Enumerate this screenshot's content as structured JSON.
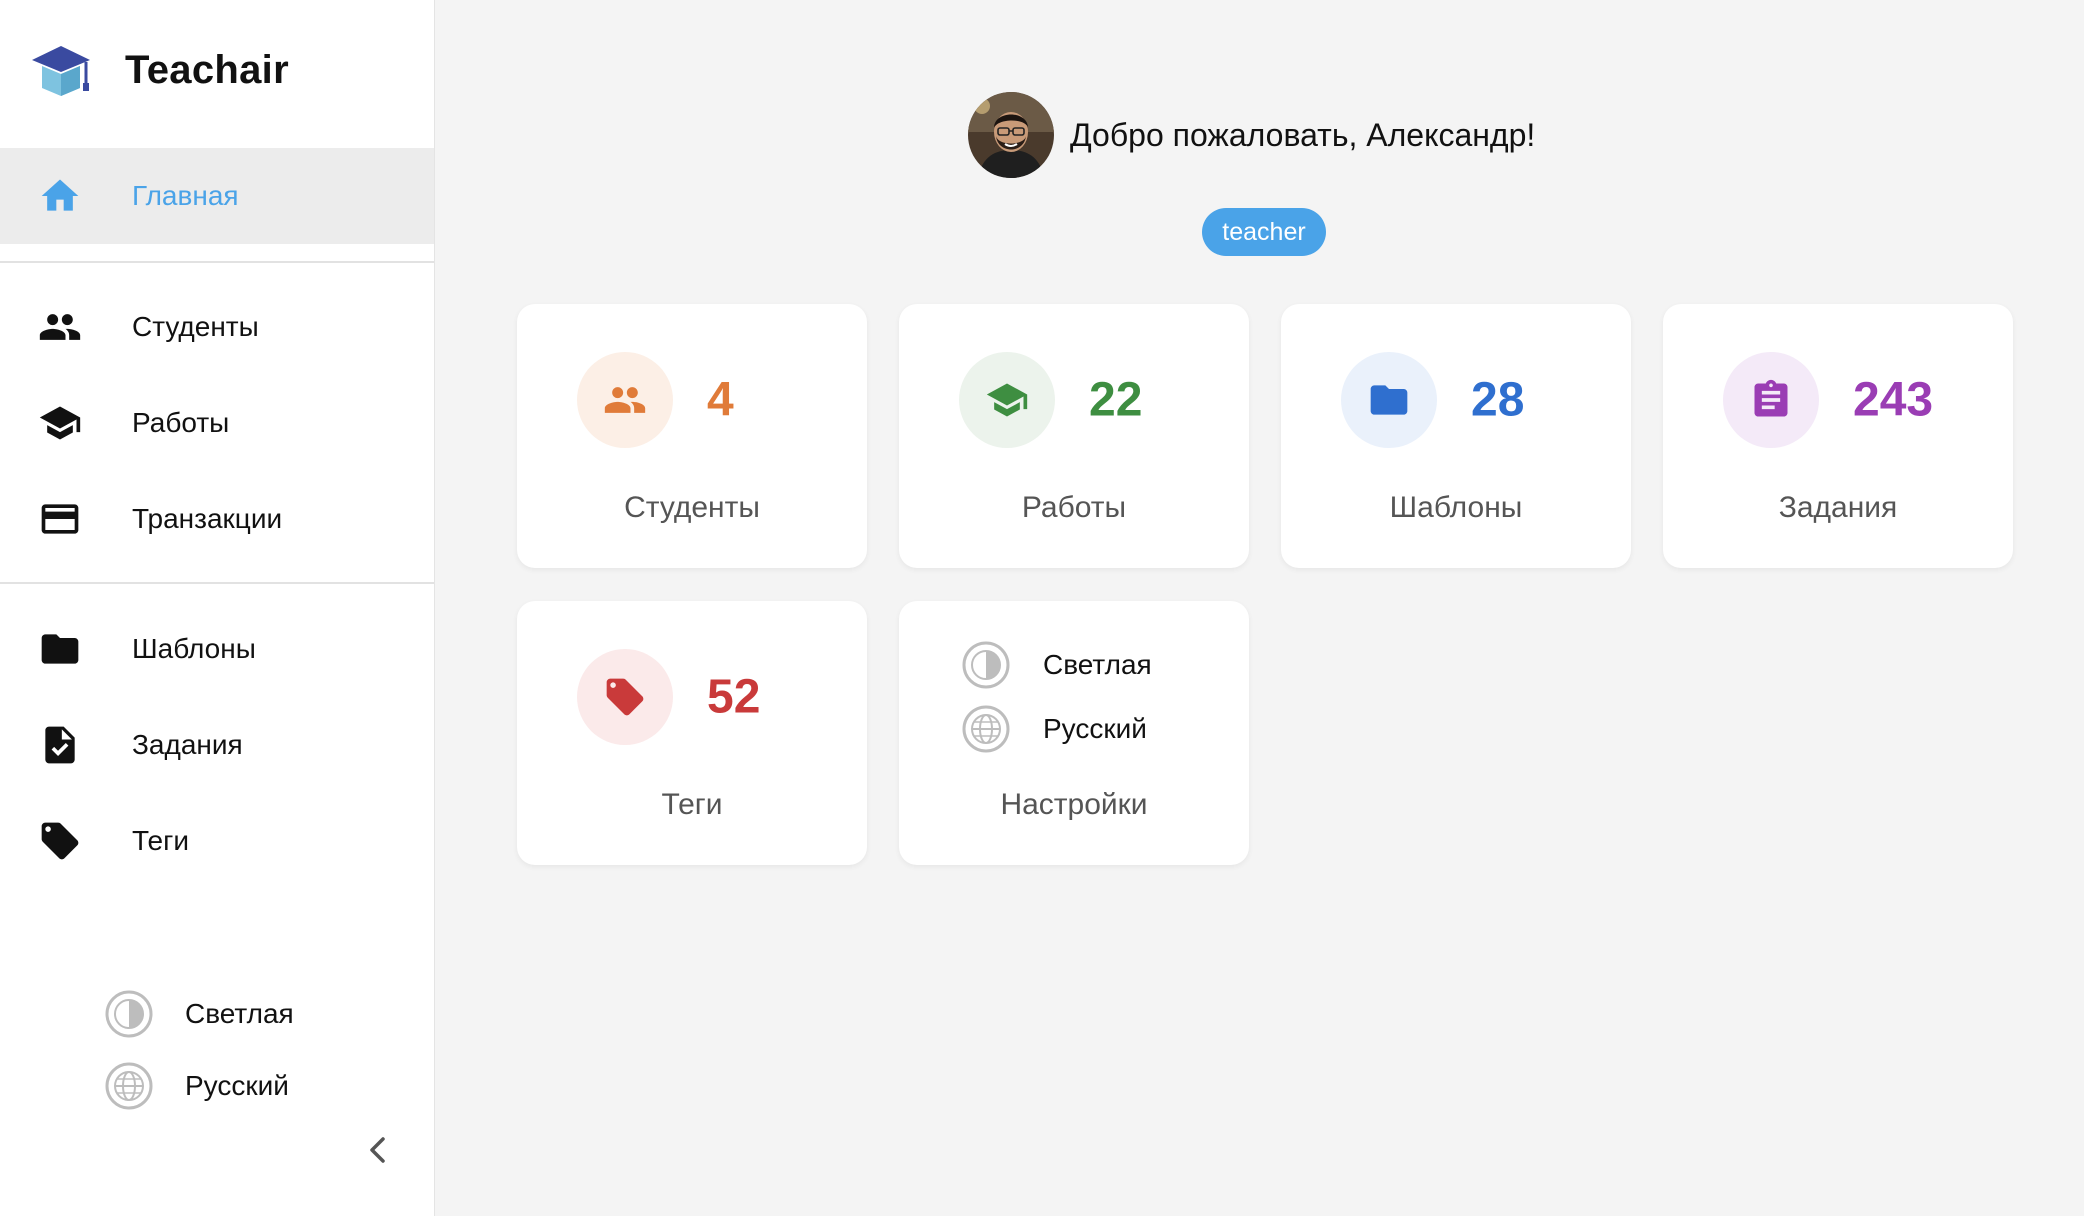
{
  "app": {
    "name": "Teachair"
  },
  "sidebar": {
    "items": [
      {
        "label": "Главная",
        "icon": "home-icon",
        "active": true
      },
      {
        "label": "Студенты",
        "icon": "people-icon"
      },
      {
        "label": "Работы",
        "icon": "graduation-cap-icon"
      },
      {
        "label": "Транзакции",
        "icon": "credit-card-icon"
      },
      {
        "label": "Шаблоны",
        "icon": "folder-icon"
      },
      {
        "label": "Задания",
        "icon": "assignment-check-icon"
      },
      {
        "label": "Теги",
        "icon": "tag-icon"
      }
    ],
    "theme_label": "Светлая",
    "language_label": "Русский"
  },
  "welcome": {
    "text": "Добро пожаловать, Александр!",
    "role": "teacher"
  },
  "cards": [
    {
      "value": "4",
      "title": "Студенты",
      "color": "#e07b39",
      "bg": "#fcefe6",
      "icon": "people-icon"
    },
    {
      "value": "22",
      "title": "Работы",
      "color": "#3e8e41",
      "bg": "#ecf3ec",
      "icon": "graduation-cap-icon"
    },
    {
      "value": "28",
      "title": "Шаблоны",
      "color": "#2f6fcf",
      "bg": "#eaf1fb",
      "icon": "folder-icon"
    },
    {
      "value": "243",
      "title": "Задания",
      "color": "#9a3db4",
      "bg": "#f4eaf8",
      "icon": "clipboard-icon"
    },
    {
      "value": "52",
      "title": "Теги",
      "color": "#c93a3a",
      "bg": "#fbeaea",
      "icon": "tag-icon"
    }
  ],
  "settings_card": {
    "theme_label": "Светлая",
    "language_label": "Русский",
    "title": "Настройки"
  },
  "colors": {
    "accent": "#4aa3e8",
    "active_bg": "#ececec",
    "page_bg": "#f4f4f4"
  }
}
